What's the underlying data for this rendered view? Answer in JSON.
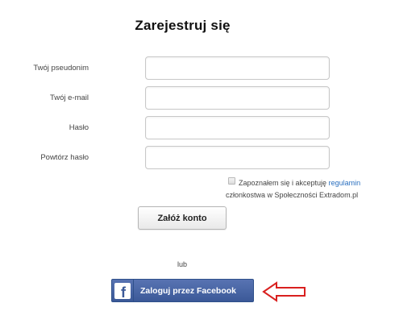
{
  "title": "Zarejestruj się",
  "fields": [
    {
      "label": "Twój pseudonim",
      "value": "",
      "placeholder": ""
    },
    {
      "label": "Twój e-mail",
      "value": "",
      "placeholder": ""
    },
    {
      "label": "Hasło",
      "value": "",
      "placeholder": ""
    },
    {
      "label": "Powtórz hasło",
      "value": "",
      "placeholder": ""
    }
  ],
  "terms": {
    "text_before": "Zapoznałem się i akceptuję",
    "link": "regulamin",
    "text_after": "członkostwa w Społeczności Extradom.pl"
  },
  "submit_label": "Załóż konto",
  "or_label": "lub",
  "facebook": {
    "label": "Zaloguj przez Facebook",
    "logo_letter": "f",
    "icon": "facebook-icon",
    "color": "#3b5998"
  },
  "arrow": {
    "icon": "arrow-left-icon",
    "color": "#d9201f"
  }
}
